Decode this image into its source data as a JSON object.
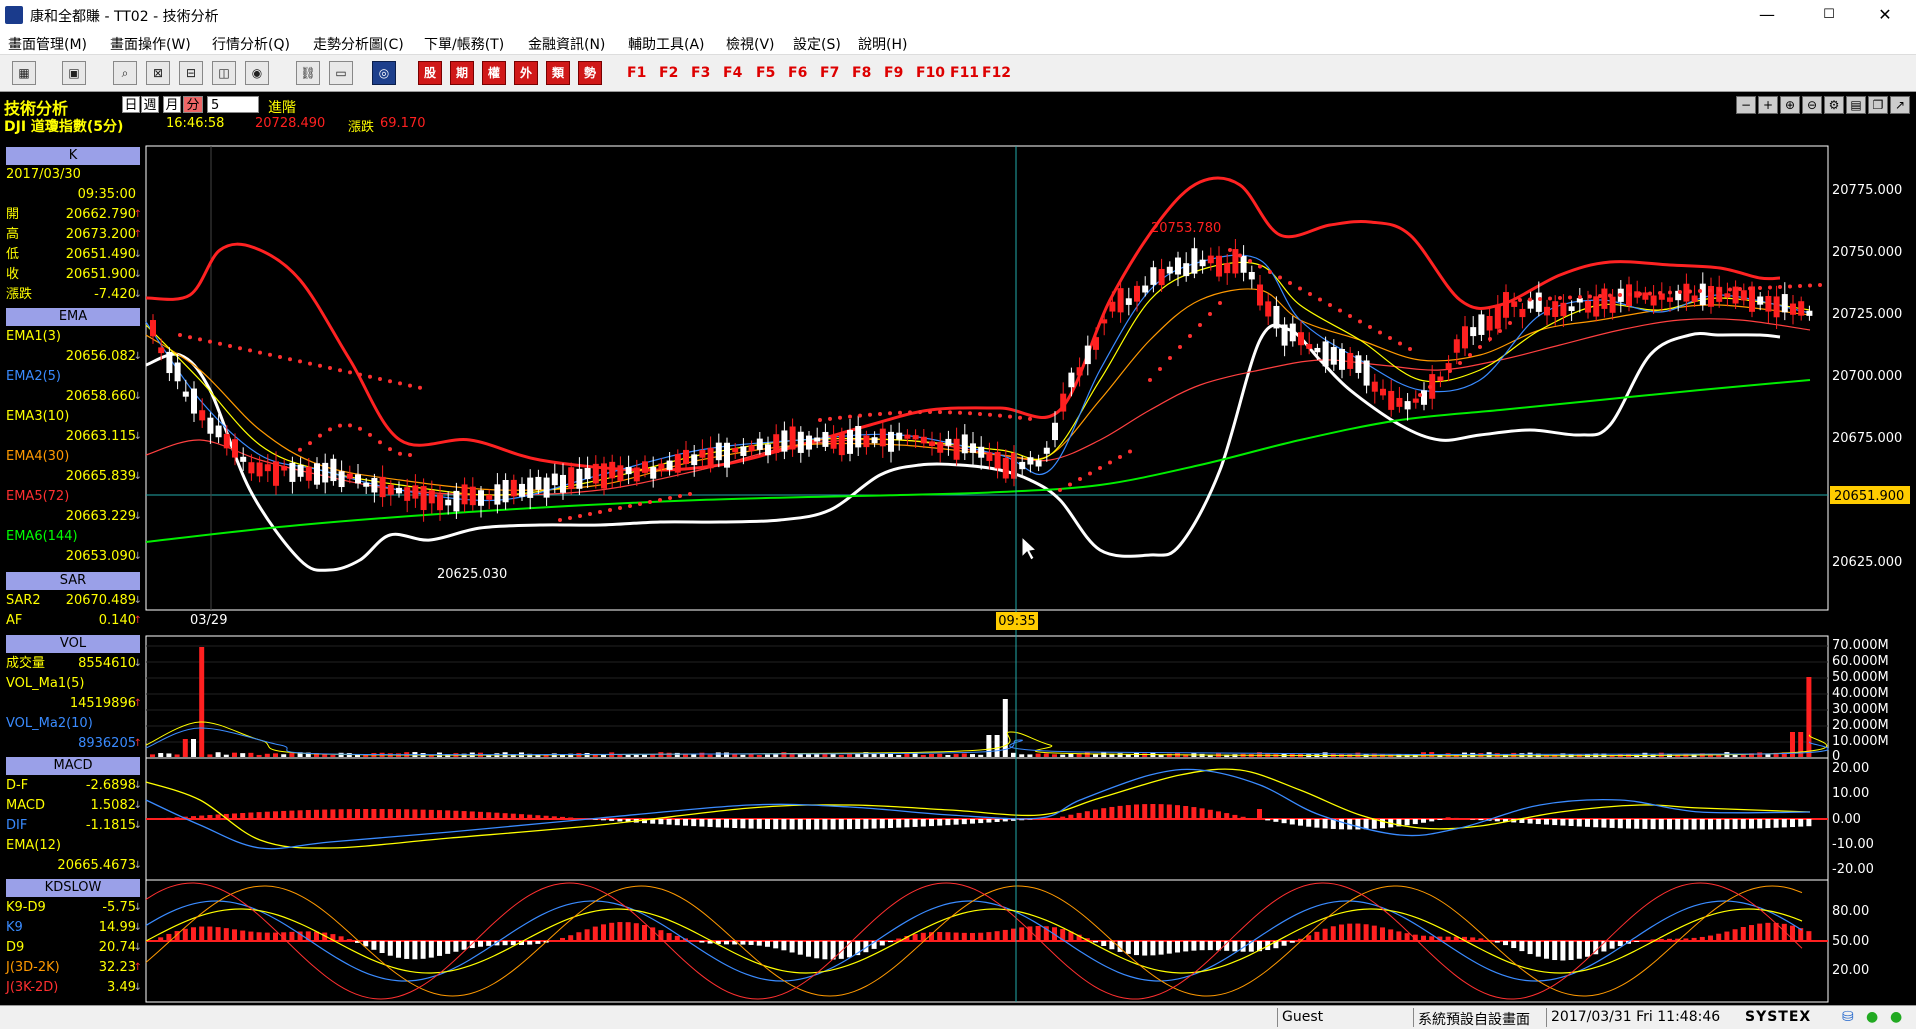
{
  "window": {
    "title": "康和全都賺 - TT02 - 技術分析",
    "minimize": "—",
    "maximize": "☐",
    "close": "✕"
  },
  "menu": [
    "畫面管理(M)",
    "畫面操作(W)",
    "行情分析(Q)",
    "走勢分析圖(C)",
    "下單/帳務(T)",
    "金融資訊(N)",
    "輔助工具(A)",
    "檢視(V)",
    "設定(S)",
    "說明(H)"
  ],
  "toolbar": {
    "quick_buttons": [
      "股",
      "期",
      "權",
      "外",
      "類",
      "勢"
    ],
    "fkeys": [
      "F1",
      "F2",
      "F3",
      "F4",
      "F5",
      "F6",
      "F7",
      "F8",
      "F9",
      "F10",
      "F11",
      "F12"
    ]
  },
  "header": {
    "title": "技術分析",
    "periods": [
      "日",
      "週",
      "月",
      "分"
    ],
    "selected_period": "分",
    "minute_value": "5",
    "advanced": "進階",
    "symbol": "DJI 道瓊指數(5分)",
    "time": "16:46:58",
    "price": "20728.490",
    "change_label": "漲跌",
    "change": "69.170"
  },
  "panel": {
    "k_title": "K",
    "date": "2017/03/30",
    "time": "09:35:00",
    "ohlc": [
      {
        "label": "開",
        "value": "20662.790",
        "dir": "up"
      },
      {
        "label": "高",
        "value": "20673.200",
        "dir": "up"
      },
      {
        "label": "低",
        "value": "20651.490",
        "dir": "down"
      },
      {
        "label": "收",
        "value": "20651.900",
        "dir": "down"
      },
      {
        "label": "漲跌",
        "value": "-7.420",
        "dir": "down"
      }
    ],
    "ema_title": "EMA",
    "ema": [
      {
        "label": "EMA1(3)",
        "value": "20656.082",
        "color": "#ffff00",
        "dir": "down"
      },
      {
        "label": "EMA2(5)",
        "value": "20658.660",
        "color": "#3a8bff",
        "dir": "down"
      },
      {
        "label": "EMA3(10)",
        "value": "20663.115",
        "color": "#ffff00",
        "dir": "down"
      },
      {
        "label": "EMA4(30)",
        "value": "20665.839",
        "color": "#ff9900",
        "dir": "down"
      },
      {
        "label": "EMA5(72)",
        "value": "20663.229",
        "color": "#ff3030",
        "dir": "down"
      },
      {
        "label": "EMA6(144)",
        "value": "20653.090",
        "color": "#00ff00",
        "dir": "down"
      }
    ],
    "sar_title": "SAR",
    "sar": [
      {
        "label": "SAR2",
        "value": "20670.489",
        "dir": "down"
      },
      {
        "label": "AF",
        "value": "0.140",
        "dir": "up"
      }
    ],
    "vol_title": "VOL",
    "vol": [
      {
        "label": "成交量",
        "value": "8554610",
        "dir": "down",
        "color": "#ffff00"
      },
      {
        "label": "VOL_Ma1(5)",
        "value": "",
        "dir": "",
        "color": "#ffff00"
      },
      {
        "label": "",
        "value": "14519896",
        "dir": "up",
        "color": "#ffff00"
      },
      {
        "label": "VOL_Ma2(10)",
        "value": "",
        "dir": "",
        "color": "#3a8bff"
      },
      {
        "label": "",
        "value": "8936205",
        "dir": "up",
        "color": "#3a8bff"
      }
    ],
    "macd_title": "MACD",
    "macd": [
      {
        "label": "D-F",
        "value": "-2.6898",
        "dir": "down",
        "color": "#ffff00"
      },
      {
        "label": "MACD",
        "value": "1.5082",
        "dir": "down",
        "color": "#ffff00"
      },
      {
        "label": "DIF",
        "value": "-1.1815",
        "dir": "down",
        "color": "#3a8bff"
      },
      {
        "label": "EMA(12)",
        "value": "",
        "dir": "",
        "color": "#ffff00"
      },
      {
        "label": "",
        "value": "20665.4673",
        "dir": "down",
        "color": "#ffff00"
      }
    ],
    "kd_title": "KDSLOW",
    "kd": [
      {
        "label": "K9-D9",
        "value": "-5.75",
        "dir": "down",
        "color": "#ffff00"
      },
      {
        "label": "K9",
        "value": "14.99",
        "dir": "down",
        "color": "#3a8bff"
      },
      {
        "label": "D9",
        "value": "20.74",
        "dir": "down",
        "color": "#ffff00"
      },
      {
        "label": "J(3D-2K)",
        "value": "32.23",
        "dir": "up",
        "color": "#ff9900"
      },
      {
        "label": "J(3K-2D)",
        "value": "3.49",
        "dir": "down",
        "color": "#ff3030"
      }
    ]
  },
  "chart": {
    "date_label": "03/29",
    "cursor_time": "09:35",
    "high_mark": "20753.780",
    "low_mark": "20625.030",
    "current_price_tag": "20651.900",
    "price_axis": [
      "20775.000",
      "20750.000",
      "20725.000",
      "20700.000",
      "20675.000",
      "20625.000"
    ],
    "vol_axis": [
      "70.000M",
      "60.000M",
      "50.000M",
      "40.000M",
      "30.000M",
      "20.000M",
      "10.000M",
      "0"
    ],
    "macd_axis": [
      "20.00",
      "10.00",
      "0.00",
      "-10.00",
      "-20.00"
    ],
    "kd_axis": [
      "80.00",
      "50.00",
      "20.00"
    ]
  },
  "status": {
    "user": "Guest",
    "layout": "系統預設自設畫面",
    "datetime": "2017/03/31 Fri 11:48:46",
    "brand": "SYSTEX"
  }
}
